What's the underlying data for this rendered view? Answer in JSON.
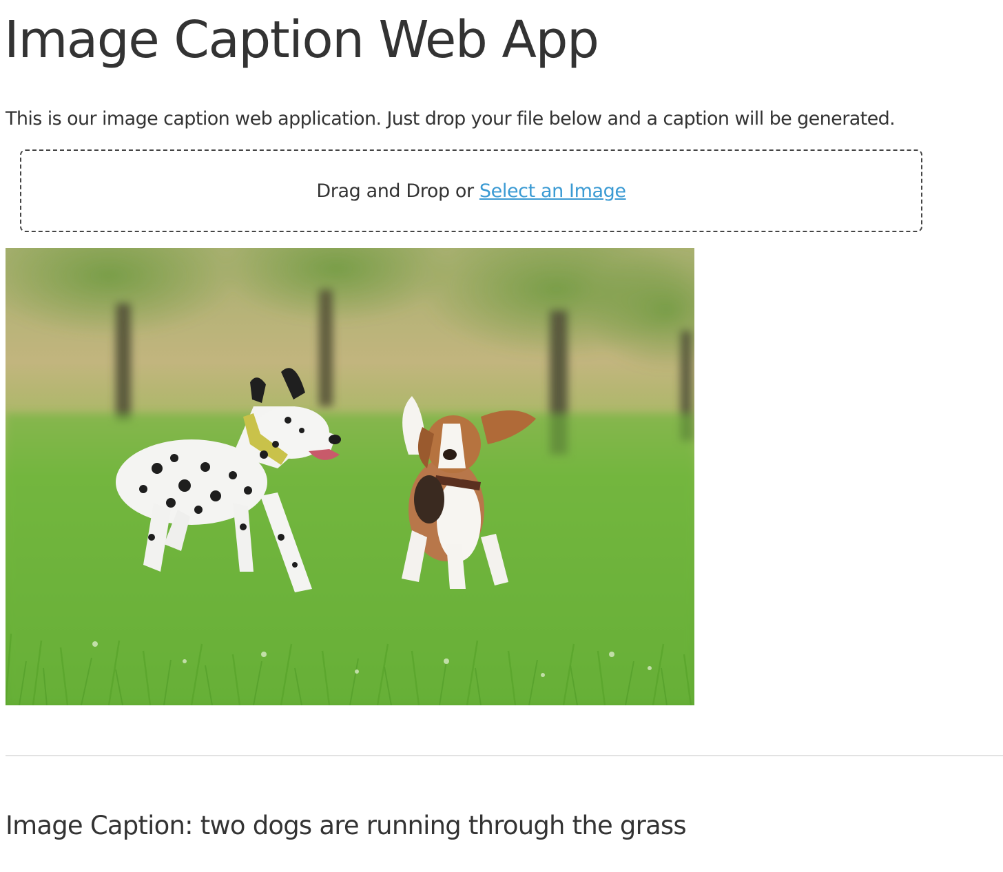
{
  "header": {
    "title": "Image Caption Web App"
  },
  "intro": {
    "text": "This is our image caption web application. Just drop your file below and a caption will be generated."
  },
  "dropzone": {
    "prompt": "Drag and Drop or",
    "link_label": "Select an Image",
    "link_color": "#3a9ad3"
  },
  "preview": {
    "alt": "Preview photo of a Dalmatian and a Beagle running on grass"
  },
  "result": {
    "caption_prefix": "Image Caption:",
    "caption_text": "two dogs are running through the grass"
  }
}
